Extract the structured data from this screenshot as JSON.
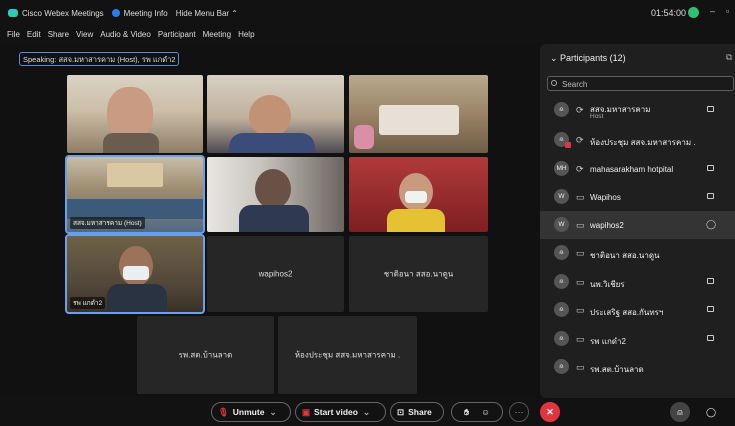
{
  "titlebar": {
    "app_name": "Cisco Webex Meetings",
    "meeting_info": "Meeting Info",
    "hide_menu": "Hide Menu Bar ⌃",
    "clock": "01:54:00",
    "minimize": "–",
    "maximize": "▫"
  },
  "menu": [
    "File",
    "Edit",
    "Share",
    "View",
    "Audio & Video",
    "Participant",
    "Meeting",
    "Help"
  ],
  "speaking": "Speaking: สสจ.มหาสารคาม (Host), รพ แกดำ2",
  "tiles": [
    {
      "name": ""
    },
    {
      "name": ""
    },
    {
      "name": ""
    },
    {
      "name": "สสจ.มหาสารคาม (Host)"
    },
    {
      "name": ""
    },
    {
      "name": ""
    },
    {
      "name": "รพ แกดำ2"
    },
    {
      "name": "wapihos2"
    },
    {
      "name": "ชาติอนา สสอ.นาดูน"
    },
    {
      "name": "รพ.สต.บ้านลาด"
    },
    {
      "name": "ห้องประชุม สสจ.มหาสารคาม ."
    }
  ],
  "participants": {
    "title": "Participants (12)",
    "search_placeholder": "Search",
    "list": [
      {
        "avatar": "",
        "name": "สสจ.มหาสารคาม",
        "role": "Host"
      },
      {
        "avatar": "",
        "name": "ห้องประชุม สสจ.มหาสารคาม ."
      },
      {
        "avatar": "MH",
        "name": "mahasarakham hotpital"
      },
      {
        "avatar": "W",
        "name": "Wapihos"
      },
      {
        "avatar": "W",
        "name": "wapihos2"
      },
      {
        "avatar": "",
        "name": "ชาติอนา สสอ.นาดูน"
      },
      {
        "avatar": "",
        "name": "นพ.วิเชียร"
      },
      {
        "avatar": "",
        "name": "ประเสริฐ สสอ.กันทรฯ"
      },
      {
        "avatar": "",
        "name": "รพ แกดำ2"
      },
      {
        "avatar": "",
        "name": "รพ.สต.บ้านลาด"
      }
    ]
  },
  "controls": {
    "unmute": "Unmute",
    "start_video": "Start video",
    "share": "Share"
  }
}
